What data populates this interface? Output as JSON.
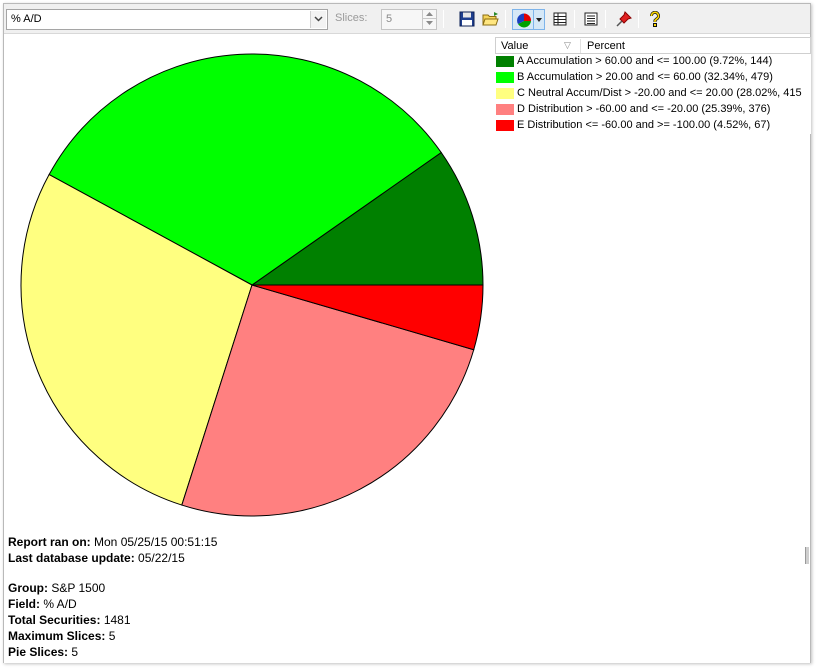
{
  "toolbar": {
    "field_value": "% A/D",
    "slices_label": "Slices:",
    "slices_value": "5",
    "buttons": [
      {
        "name": "save-icon"
      },
      {
        "name": "open-folder-icon"
      },
      {
        "name": "pie-chart-icon"
      },
      {
        "name": "table-view-icon"
      },
      {
        "name": "list-view-icon"
      },
      {
        "name": "pin-icon"
      },
      {
        "name": "help-icon"
      }
    ]
  },
  "legend": {
    "header_value": "Value",
    "header_percent": "Percent",
    "sort_glyph": "▽",
    "items": [
      {
        "label": "A Accumulation    > 60.00 and <= 100.00 (9.72%, 144)",
        "color": "#008000"
      },
      {
        "label": "B Accumulation    > 20.00 and <= 60.00 (32.34%, 479)",
        "color": "#00ff00"
      },
      {
        "label": "C Neutral Accum/Dist    > -20.00 and <= 20.00 (28.02%, 415",
        "color": "#ffff80"
      },
      {
        "label": "D Distribution    > -60.00 and <= -20.00 (25.39%, 376)",
        "color": "#ff8080"
      },
      {
        "label": "E Distribution    <= -60.00 and >= -100.00 (4.52%, 67)",
        "color": "#ff0000"
      }
    ]
  },
  "chart_data": {
    "type": "pie",
    "slices": [
      {
        "name": "A Accumulation",
        "percent": 9.72,
        "count": 144,
        "color": "#008000"
      },
      {
        "name": "B Accumulation",
        "percent": 32.34,
        "count": 479,
        "color": "#00ff00"
      },
      {
        "name": "C Neutral Accum/Dist",
        "percent": 28.02,
        "count": 415,
        "color": "#ffff80"
      },
      {
        "name": "D Distribution",
        "percent": 25.39,
        "count": 376,
        "color": "#ff8080"
      },
      {
        "name": "E Distribution",
        "percent": 4.52,
        "count": 67,
        "color": "#ff0000"
      }
    ],
    "start": "3 o'clock",
    "direction": "counter-clockwise"
  },
  "info": {
    "report_label": "Report ran on:",
    "report_value": "Mon 05/25/15 00:51:15",
    "db_label": "Last database update:",
    "db_value": "05/22/15",
    "group_label": "Group:",
    "group_value": "S&P 1500",
    "field_label": "Field:",
    "field_value": "% A/D",
    "total_label": "Total Securities:",
    "total_value": "1481",
    "max_label": "Maximum Slices:",
    "max_value": "5",
    "pie_label": "Pie Slices:",
    "pie_value": "5"
  }
}
